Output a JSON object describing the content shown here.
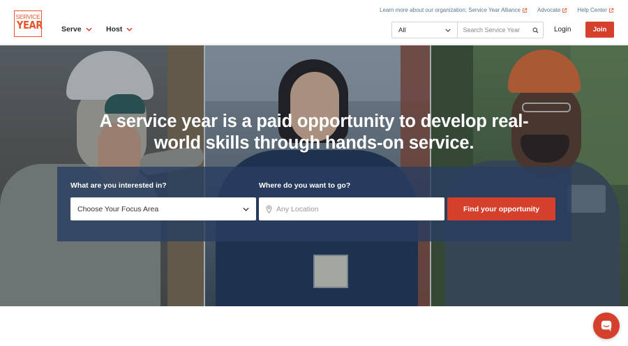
{
  "brand": {
    "logo_top": "SERVICE",
    "logo_bottom": "YEAR",
    "accent_color": "#d4402c"
  },
  "nav": {
    "items": [
      {
        "label": "Serve",
        "icon": "chevron-down-icon"
      },
      {
        "label": "Host",
        "icon": "chevron-down-icon"
      }
    ]
  },
  "top_links": [
    {
      "label": "Learn more about our organization; Service Year Alliance",
      "icon": "external-link-icon"
    },
    {
      "label": "Advocate",
      "icon": "external-link-icon"
    },
    {
      "label": "Help Center",
      "icon": "external-link-icon"
    }
  ],
  "search": {
    "category_value": "All",
    "placeholder": "Search Service Year",
    "icon": "search-icon"
  },
  "account": {
    "login_label": "Login",
    "join_label": "Join"
  },
  "hero": {
    "title": "A service year is a paid opportunity to develop real-world skills through hands-on service.",
    "interest_label": "What are you interested in?",
    "focus_select_value": "Choose Your Focus Area",
    "where_label": "Where do you want to go?",
    "location_placeholder": "Any Location",
    "location_icon": "map-pin-icon",
    "find_button_label": "Find your opportunity"
  },
  "chat": {
    "icon": "chat-icon"
  }
}
